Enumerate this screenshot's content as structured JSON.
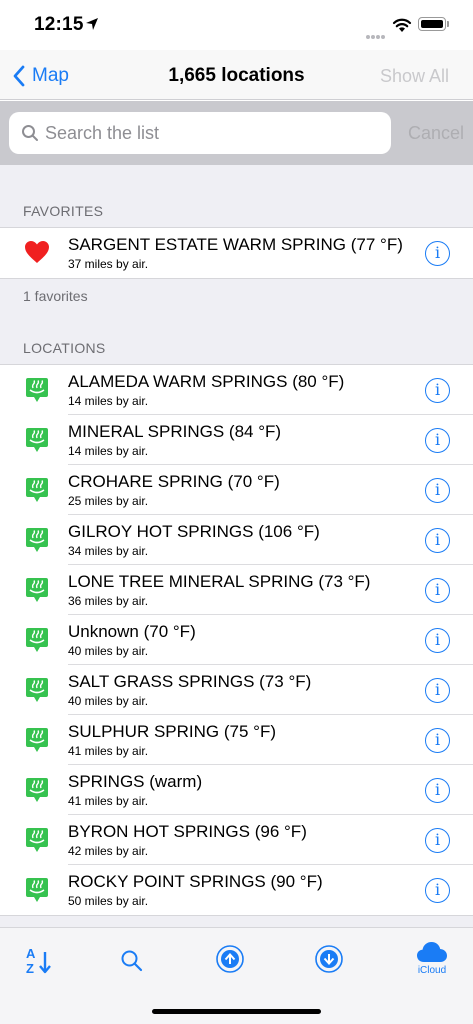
{
  "status_bar": {
    "time": "12:15"
  },
  "nav": {
    "back_label": "Map",
    "title": "1,665 locations",
    "right_label": "Show All"
  },
  "search": {
    "placeholder": "Search the list",
    "cancel_label": "Cancel"
  },
  "favorites": {
    "header": "FAVORITES",
    "footer": "1 favorites",
    "items": [
      {
        "title": "SARGENT ESTATE WARM SPRING (77 °F)",
        "subtitle": "37 miles by air.",
        "icon": "heart-icon"
      }
    ]
  },
  "locations": {
    "header": "LOCATIONS",
    "items": [
      {
        "title": "ALAMEDA WARM SPRINGS (80 °F)",
        "subtitle": "14 miles by air.",
        "icon": "hot-spring-icon"
      },
      {
        "title": "MINERAL SPRINGS (84 °F)",
        "subtitle": "14 miles by air.",
        "icon": "hot-spring-icon"
      },
      {
        "title": "CROHARE SPRING (70 °F)",
        "subtitle": "25 miles by air.",
        "icon": "hot-spring-icon"
      },
      {
        "title": "GILROY HOT SPRINGS (106 °F)",
        "subtitle": "34 miles by air.",
        "icon": "hot-spring-icon"
      },
      {
        "title": "LONE TREE MINERAL SPRING (73 °F)",
        "subtitle": "36 miles by air.",
        "icon": "hot-spring-icon"
      },
      {
        "title": "Unknown (70 °F)",
        "subtitle": "40 miles by air.",
        "icon": "hot-spring-icon"
      },
      {
        "title": "SALT GRASS SPRINGS (73 °F)",
        "subtitle": "40 miles by air.",
        "icon": "hot-spring-icon"
      },
      {
        "title": "SULPHUR SPRING (75 °F)",
        "subtitle": "41 miles by air.",
        "icon": "hot-spring-icon"
      },
      {
        "title": "SPRINGS (warm)",
        "subtitle": "41 miles by air.",
        "icon": "hot-spring-icon"
      },
      {
        "title": "BYRON HOT SPRINGS (96 °F)",
        "subtitle": "42 miles by air.",
        "icon": "hot-spring-icon"
      },
      {
        "title": "ROCKY POINT SPRINGS (90 °F)",
        "subtitle": "50 miles by air.",
        "icon": "hot-spring-icon"
      }
    ]
  },
  "tab_bar": {
    "items": [
      {
        "name": "sort-az-icon"
      },
      {
        "name": "search-icon"
      },
      {
        "name": "upload-icon"
      },
      {
        "name": "download-icon"
      },
      {
        "name": "icloud-icon",
        "label": "iCloud"
      }
    ]
  },
  "colors": {
    "accent": "#1a7cf5",
    "spring_icon": "#36c24f",
    "heart": "#f02020"
  }
}
